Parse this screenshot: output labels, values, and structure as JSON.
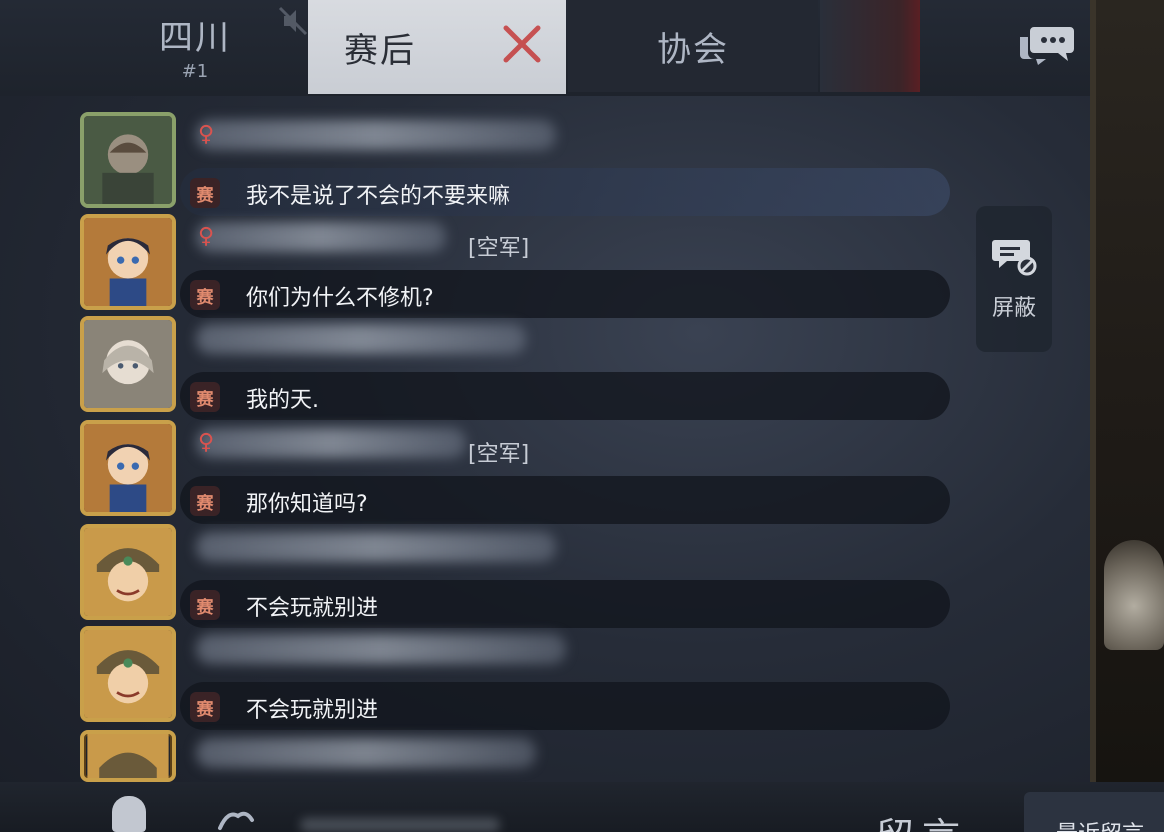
{
  "tabs": {
    "region": {
      "label": "四川",
      "rank": "#1"
    },
    "postgame": {
      "label": "赛后"
    },
    "association": {
      "label": "协会"
    }
  },
  "block_button": {
    "label": "屏蔽"
  },
  "bottom": {
    "leave_message_label": "留言",
    "recent_label": "最近留言"
  },
  "badge_label": "赛",
  "messages": [
    {
      "gender": "♀",
      "tag": "",
      "text": "我不是说了不会的不要来嘛"
    },
    {
      "gender": "♀",
      "tag": "[空军]",
      "text": "你们为什么不修机?"
    },
    {
      "gender": "",
      "tag": "",
      "text": "我的天."
    },
    {
      "gender": "♀",
      "tag": "[空军]",
      "text": "那你知道吗?"
    },
    {
      "gender": "",
      "tag": "",
      "text": "不会玩就别进"
    },
    {
      "gender": "",
      "tag": "",
      "text": "不会玩就别进"
    }
  ],
  "colors": {
    "accent_red": "#d9534f",
    "badge_text": "#e08a6e",
    "avatar_gold": "#c9a04a"
  },
  "icons": [
    "mute-icon",
    "close-x-icon",
    "chat-bubbles-icon",
    "block-icon",
    "mic-icon",
    "emoji-icon"
  ]
}
